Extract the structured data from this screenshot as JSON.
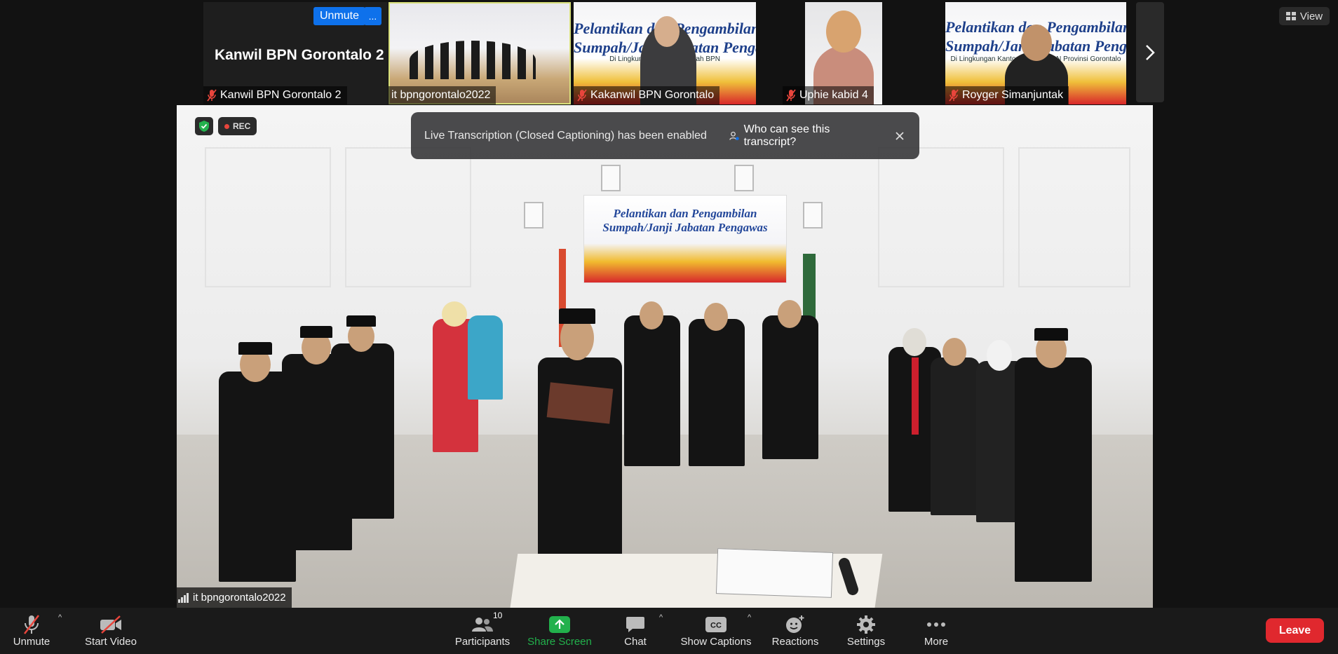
{
  "strip": {
    "self": {
      "big_name": "Kanwil BPN Gorontalo 2",
      "label": "Kanwil BPN Gorontalo 2",
      "unmute": "Unmute",
      "more": "..."
    },
    "tiles": [
      {
        "label": "it bpngorontalo2022"
      },
      {
        "label": "Kakanwil BPN Gorontalo",
        "banner_line1": "Pelantikan dan Pengambilan",
        "banner_line2": "Sumpah/Janji Jabatan Pengawas",
        "banner_sub": "Di Lingkungan Kantor Wilayah BPN"
      },
      {
        "label": "Uphie kabid 4"
      },
      {
        "label": "Royger Simanjuntak",
        "banner_line1": "Pelantikan dan Pengambilan",
        "banner_line2": "Sumpah/Janji Jabatan Pengawas",
        "banner_sub": "Di Lingkungan Kantor Wilayah BPN Provinsi Gorontalo"
      }
    ],
    "view_label": "View"
  },
  "main": {
    "rec_label": "REC",
    "backdrop_line1": "Pelantikan dan Pengambilan",
    "backdrop_line2": "Sumpah/Janji Jabatan Pengawas",
    "speaker": "it bpngorontalo2022"
  },
  "toast": {
    "message": "Live Transcription (Closed Captioning) has been enabled",
    "who_button": "Who can see this transcript?"
  },
  "toolbar": {
    "unmute": "Unmute",
    "start_video": "Start Video",
    "participants": "Participants",
    "participants_count": "10",
    "share_screen": "Share Screen",
    "chat": "Chat",
    "show_captions": "Show Captions",
    "reactions": "Reactions",
    "settings": "Settings",
    "more": "More",
    "leave": "Leave"
  },
  "colors": {
    "accent_blue": "#0e71eb",
    "share_green": "#22b14c",
    "leave_red": "#e0282e",
    "active_outline": "#d8e07a"
  },
  "icons": [
    "mic-muted-icon",
    "video-off-icon",
    "participants-icon",
    "share-screen-icon",
    "chat-icon",
    "cc-icon",
    "reactions-icon",
    "settings-icon",
    "more-icon",
    "shield-icon",
    "signal-icon",
    "chevron-right-icon",
    "grid-view-icon",
    "close-icon"
  ]
}
